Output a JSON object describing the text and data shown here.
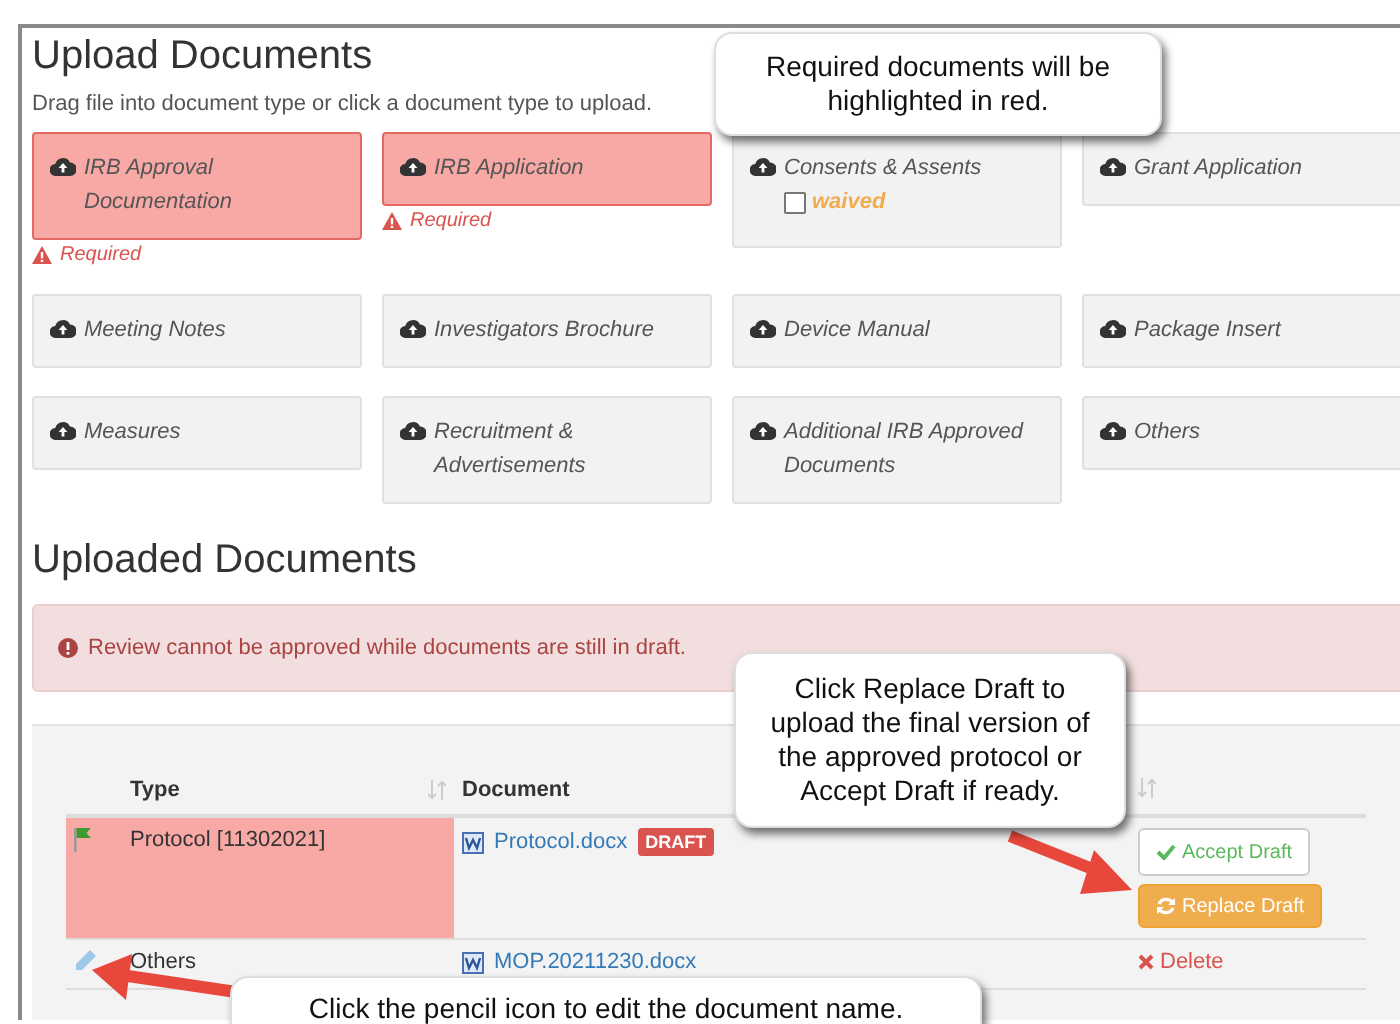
{
  "upload": {
    "title": "Upload Documents",
    "hint": "Drag file into document type or click a document type to upload.",
    "types": [
      {
        "label": "IRB Approval Documentation",
        "required": true,
        "required_text": "Required"
      },
      {
        "label": "IRB Application",
        "required": true,
        "required_text": "Required"
      },
      {
        "label": "Consents & Assents",
        "required": false,
        "waiver": {
          "label": "waived",
          "checked": false
        }
      },
      {
        "label": "Grant Application",
        "required": false
      },
      {
        "label": "Meeting Notes",
        "required": false
      },
      {
        "label": "Investigators Brochure",
        "required": false
      },
      {
        "label": "Device Manual",
        "required": false
      },
      {
        "label": "Package Insert",
        "required": false
      },
      {
        "label": "Measures",
        "required": false
      },
      {
        "label": "Recruitment & Advertisements",
        "required": false
      },
      {
        "label": "Additional IRB Approved Documents",
        "required": false
      },
      {
        "label": "Others",
        "required": false
      }
    ]
  },
  "uploaded": {
    "title": "Uploaded Documents",
    "alert": "Review cannot be approved while documents are still in draft.",
    "columns": [
      "Type",
      "Document"
    ],
    "rows": [
      {
        "kind": "flag",
        "type": "Protocol [11302021]",
        "document": "Protocol.docx",
        "badge": "DRAFT",
        "highlighted": true,
        "actions": [
          {
            "kind": "accept",
            "label": "Accept Draft"
          },
          {
            "kind": "replace",
            "label": "Replace Draft"
          }
        ]
      },
      {
        "kind": "pencil",
        "type": "Others",
        "document": "MOP.20211230.docx",
        "highlighted": false,
        "actions": [
          {
            "kind": "delete",
            "label": "Delete"
          }
        ]
      }
    ]
  },
  "callouts": [
    {
      "text": "Required documents will be highlighted in red."
    },
    {
      "text": "Click Replace Draft to upload the final version of the approved protocol or Accept Draft if ready."
    },
    {
      "text": "Click the pencil icon to edit the document name."
    }
  ]
}
